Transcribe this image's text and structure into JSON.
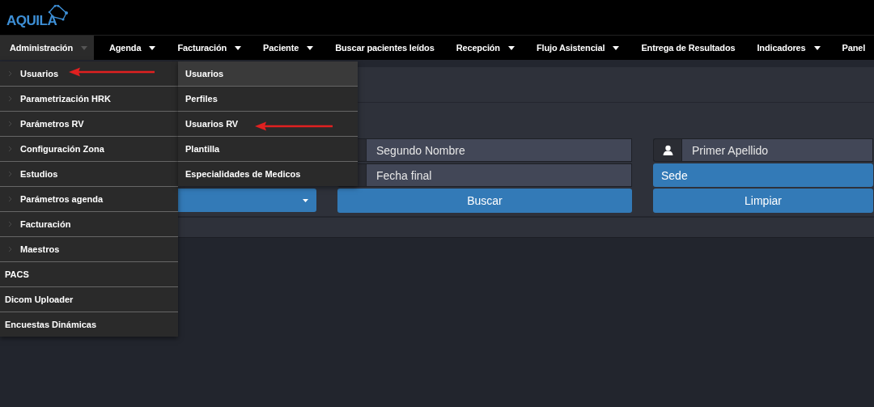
{
  "logo": {
    "text": "AQUILA"
  },
  "nav": [
    {
      "label": "Administración",
      "selected": true,
      "dropdown": true
    },
    {
      "label": "Agenda",
      "selected": false,
      "dropdown": true
    },
    {
      "label": "Facturación",
      "selected": false,
      "dropdown": true
    },
    {
      "label": "Paciente",
      "selected": false,
      "dropdown": true
    },
    {
      "label": "Buscar pacientes leídos",
      "selected": false,
      "dropdown": false
    },
    {
      "label": "Recepción",
      "selected": false,
      "dropdown": true
    },
    {
      "label": "Flujo Asistencial",
      "selected": false,
      "dropdown": true
    },
    {
      "label": "Entrega de Resultados",
      "selected": false,
      "dropdown": false
    },
    {
      "label": "Indicadores",
      "selected": false,
      "dropdown": true
    },
    {
      "label": "Panel",
      "selected": false,
      "dropdown": false
    }
  ],
  "admin_menu": [
    {
      "label": "Usuarios",
      "submenu": true
    },
    {
      "label": "Parametrización HRK",
      "submenu": true
    },
    {
      "label": "Parámetros RV",
      "submenu": true
    },
    {
      "label": "Configuración Zona",
      "submenu": true
    },
    {
      "label": "Estudios",
      "submenu": true
    },
    {
      "label": "Parámetros agenda",
      "submenu": true
    },
    {
      "label": "Facturación",
      "submenu": true
    },
    {
      "label": "Maestros",
      "submenu": true
    },
    {
      "label": "PACS",
      "submenu": false
    },
    {
      "label": "Dicom Uploader",
      "submenu": false
    },
    {
      "label": "Encuestas Dinámicas",
      "submenu": false
    }
  ],
  "users_submenu": [
    {
      "label": "Usuarios",
      "selected": true
    },
    {
      "label": "Perfiles",
      "selected": false
    },
    {
      "label": "Usuarios RV",
      "selected": false
    },
    {
      "label": "Plantilla",
      "selected": false
    },
    {
      "label": "Especialidades de Medicos",
      "selected": false
    }
  ],
  "search_form": {
    "second_name": {
      "placeholder": "Segundo Nombre"
    },
    "first_surname": {
      "placeholder": "Primer Apellido"
    },
    "end_date": {
      "placeholder": "Fecha final"
    },
    "site_select": {
      "value": "Sede"
    },
    "search_button": "Buscar",
    "clear_button": "Limpiar"
  }
}
